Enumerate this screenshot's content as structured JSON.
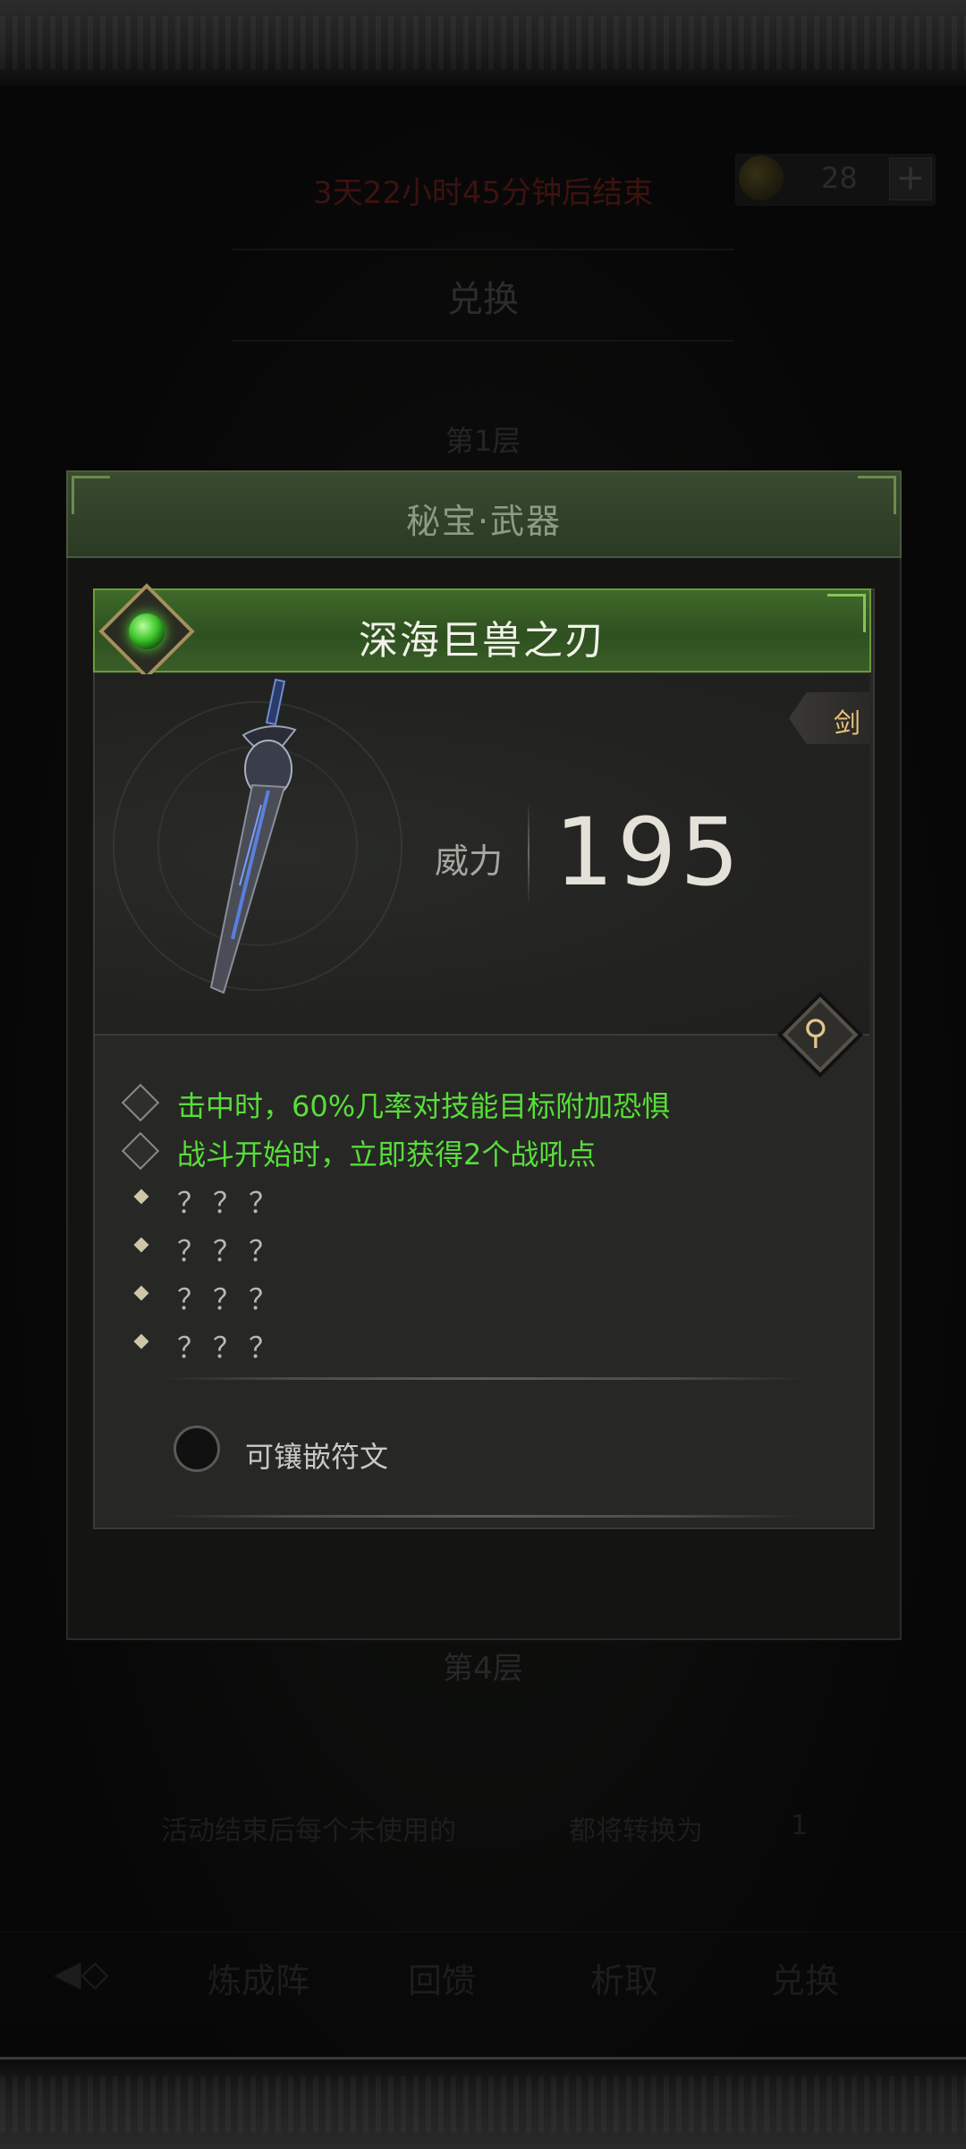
{
  "background": {
    "timer_text": "3天22小时45分钟后结束",
    "currency_count": "28",
    "plus_symbol": "+",
    "exchange_title": "兑换",
    "floor_1": "第1层",
    "floor_4": "第4层",
    "note_before": "活动结束后每个未使用的",
    "note_after": "都将转换为",
    "note_count": "1",
    "nav": [
      "炼成阵",
      "回馈",
      "析取",
      "兑换"
    ]
  },
  "panel": {
    "header": "秘宝·武器"
  },
  "item": {
    "name": "深海巨兽之刃",
    "type_tag": "剑",
    "power_label": "威力",
    "power_value": "195",
    "rarity_color": "#52e036",
    "effects": [
      "击中时，60%几率对技能目标附加恐惧",
      "战斗开始时，立即获得2个战吼点"
    ],
    "unknown_effects": [
      "？？？",
      "？？？",
      "？？？",
      "？？？"
    ],
    "rune_label": "可镶嵌符文"
  },
  "colors": {
    "effect_green": "#58dd3a",
    "header_green": "#3f6a2a",
    "tag_gold": "#e8c47a"
  },
  "icons": {
    "zoom": "magnifier-icon",
    "lock": "lock-icon",
    "badge": "green-gem-rarity-icon"
  }
}
